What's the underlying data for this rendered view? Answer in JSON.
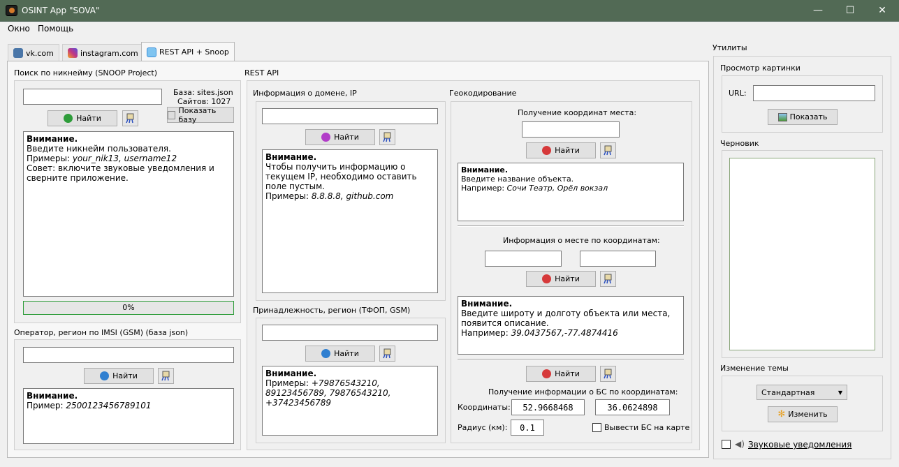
{
  "window": {
    "title": "OSINT App \"SOVA\"",
    "min": "—",
    "max": "☐",
    "close": "✕"
  },
  "menu": {
    "items": [
      "Окно",
      "Помощь"
    ]
  },
  "tabs": [
    {
      "label": "vk.com",
      "icon": "vk-icon",
      "color": "#4a76a8"
    },
    {
      "label": "instagram.com",
      "icon": "instagram-icon",
      "color": "#c13584"
    },
    {
      "label": "REST API + Snoop",
      "icon": "rest-api-icon",
      "color": "#3b8fd9"
    }
  ],
  "snoop": {
    "title": "Поиск по никнейму (SNOOP Project)",
    "base_label": "База: sites.json",
    "sites_label": "Сайтов: 1027",
    "show_base": "Показать базу",
    "find": "Найти",
    "notice_title": "Внимание.",
    "notice_line1": "Введите никнейм пользователя.",
    "examples_prefix": "Примеры: ",
    "examples": "your_nik13, username12",
    "advice": "Совет: включите звуковые уведомления и сверните приложение.",
    "progress": "0%",
    "progress_value": 0
  },
  "imsi": {
    "title": "Оператор, регион по IMSI (GSM) (база json)",
    "find": "Найти",
    "notice_title": "Внимание.",
    "example_prefix": "Пример: ",
    "example": "250012345678910​1"
  },
  "rest": {
    "title": "REST API",
    "domain": {
      "title": "Информация о домене, IP",
      "find": "Найти",
      "notice_title": "Внимание.",
      "text": "Чтобы получить информацию о текущем IP, необходимо оставить поле пустым.",
      "examples_prefix": "Примеры: ",
      "examples": "8.8.8.8, github.com"
    },
    "phone": {
      "title": "Принадлежность, регион (ТФОП, GSM)",
      "find": "Найти",
      "notice_title": "Внимание.",
      "examples_prefix": "Примеры: ",
      "examples": "+79876543210, 89123456789, 79876543210, +37423456789"
    }
  },
  "geo": {
    "title": "Геокодирование",
    "get_coords_label": "Получение координат места:",
    "find": "Найти",
    "notice1_title": "Внимание.",
    "notice1_text": "Введите название объекта.",
    "notice1_example_prefix": "Например: ",
    "notice1_example": "Сочи Театр, Орёл вокзал",
    "place_info_label": "Информация о месте по координатам:",
    "notice2_title": "Внимание.",
    "notice2_text": "Введите широту и долготу объекта или места, появится описание.",
    "notice2_example_prefix": "Например: ",
    "notice2_example": "39.0437567,-77.4874416",
    "bs_label": "Получение информации о БС по координатам:",
    "coords_label": "Координаты:",
    "lat": "52.9668468",
    "lon": "36.0624898",
    "radius_label": "Радиус (км):",
    "radius": "0.1",
    "show_map": "Вывести БС на карте"
  },
  "utils": {
    "title": "Утилиты",
    "image_view": "Просмотр картинки",
    "url_label": "URL:",
    "show": "Показать",
    "draft": "Черновик",
    "theme_title": "Изменение темы",
    "theme_value": "Стандартная",
    "change": "Изменить",
    "sound": "Звуковые уведомления"
  },
  "colors": {
    "titlebar": "#526a55",
    "green": "#2e9c3a",
    "purple": "#b13cc8",
    "blue": "#2f7fd0",
    "red": "#d6393a"
  }
}
